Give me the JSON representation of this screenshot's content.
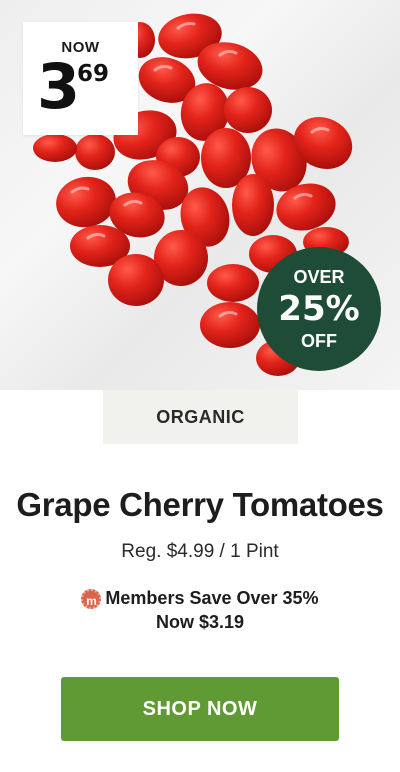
{
  "price_tag": {
    "label": "NOW",
    "dollars": "3",
    "cents": "69"
  },
  "discount_badge": {
    "line1": "OVER",
    "line2": "25%",
    "line3": "OFF",
    "color": "#1f4c36"
  },
  "product": {
    "tag": "ORGANIC",
    "name": "Grape Cherry Tomatoes",
    "regular_price": "Reg. $4.99 / 1 Pint",
    "members_save": "Members Save Over 35%",
    "members_price": "Now $3.19",
    "members_icon": "m-badge-icon",
    "members_icon_letter": "m"
  },
  "cta": {
    "label": "SHOP NOW",
    "color": "#5f9a35"
  },
  "image": {
    "subject": "tomatoes-image"
  }
}
